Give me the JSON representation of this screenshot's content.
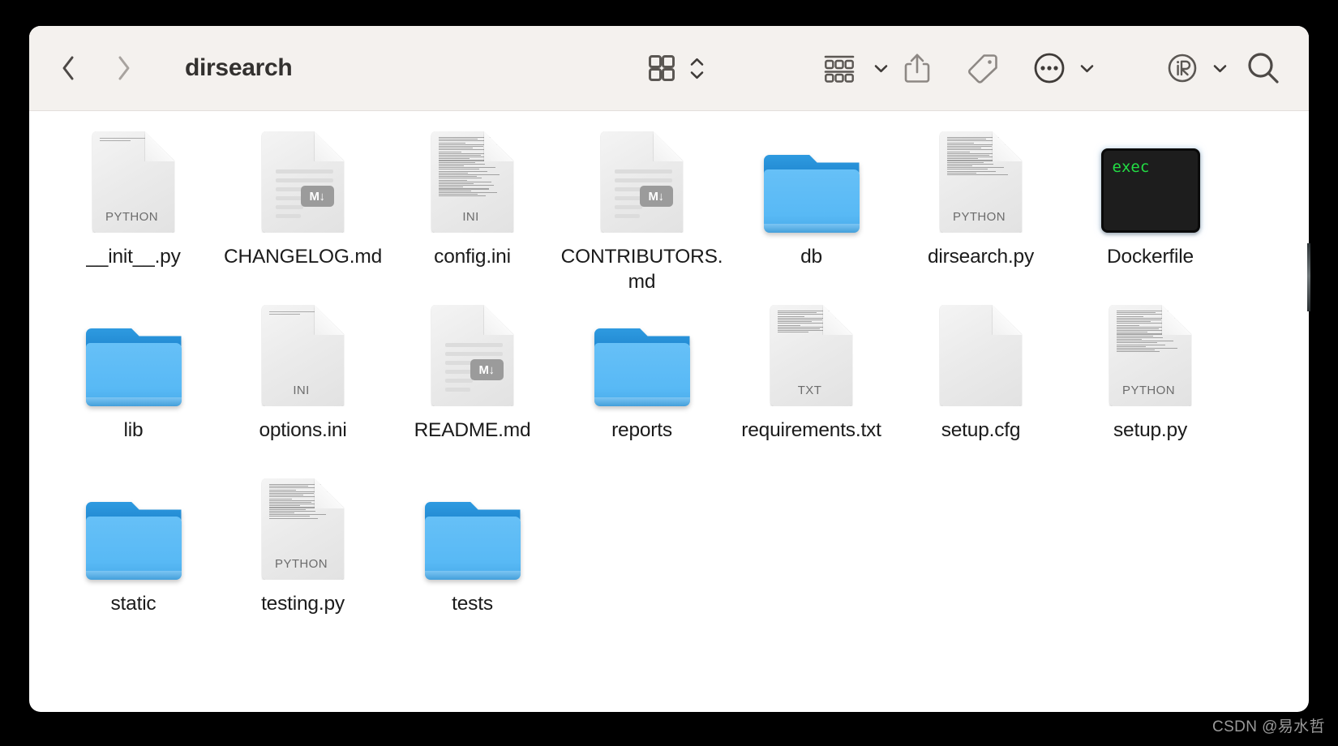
{
  "window": {
    "title": "dirsearch",
    "toolbar_bg": "#f4f1ee",
    "content_bg": "#ffffff",
    "desktop_bg": "#000000"
  },
  "toolbar": {
    "back_label": "Back",
    "forward_label": "Forward",
    "view_icon_label": "Icon view",
    "view_sort_label": "Sort order",
    "group_label": "Group items",
    "group_chevron_label": "Group menu",
    "share_label": "Share",
    "tags_label": "Tags",
    "more_label": "More",
    "more_chevron_label": "More menu",
    "ir_label": "iR",
    "ir_chevron_label": "iR menu",
    "search_label": "Search",
    "icons": [
      "back-chevron-icon",
      "forward-chevron-icon",
      "grid-view-icon",
      "sort-chevrons-icon",
      "group-rows-icon",
      "chevron-down-icon",
      "share-icon",
      "tag-icon",
      "more-circle-icon",
      "chevron-down-icon",
      "ir-circle-icon",
      "chevron-down-icon",
      "search-icon"
    ]
  },
  "files": [
    {
      "name": "__init__.py",
      "type": "document",
      "kind": "PYTHON",
      "style": "code",
      "lines": 2
    },
    {
      "name": "CHANGELOG.md",
      "type": "document",
      "kind": "",
      "style": "md",
      "lines": 5
    },
    {
      "name": "config.ini",
      "type": "document",
      "kind": "INI",
      "style": "dense",
      "lines": 34
    },
    {
      "name": "CONTRIBUTORS.md",
      "type": "document",
      "kind": "",
      "style": "md",
      "lines": 5
    },
    {
      "name": "db",
      "type": "folder",
      "kind": "",
      "style": "",
      "lines": 0
    },
    {
      "name": "dirsearch.py",
      "type": "document",
      "kind": "PYTHON",
      "style": "dense",
      "lines": 22
    },
    {
      "name": "Dockerfile",
      "type": "exec",
      "kind": "",
      "style": "",
      "lines": 0,
      "exec_text": "exec"
    },
    {
      "name": "lib",
      "type": "folder",
      "kind": "",
      "style": "",
      "lines": 0
    },
    {
      "name": "options.ini",
      "type": "document",
      "kind": "INI",
      "style": "code",
      "lines": 2
    },
    {
      "name": "README.md",
      "type": "document",
      "kind": "",
      "style": "md",
      "lines": 5
    },
    {
      "name": "reports",
      "type": "folder",
      "kind": "",
      "style": "",
      "lines": 0
    },
    {
      "name": "requirements.txt",
      "type": "document",
      "kind": "TXT",
      "style": "dense",
      "lines": 13
    },
    {
      "name": "setup.cfg",
      "type": "document",
      "kind": "",
      "style": "blank",
      "lines": 0
    },
    {
      "name": "setup.py",
      "type": "document",
      "kind": "PYTHON",
      "style": "dense",
      "lines": 24
    },
    {
      "name": "static",
      "type": "folder",
      "kind": "",
      "style": "",
      "lines": 0
    },
    {
      "name": "testing.py",
      "type": "document",
      "kind": "PYTHON",
      "style": "dense",
      "lines": 20
    },
    {
      "name": "tests",
      "type": "folder",
      "kind": "",
      "style": "",
      "lines": 0
    }
  ],
  "markdown_badge": "M↓",
  "watermark": "CSDN @易水哲"
}
